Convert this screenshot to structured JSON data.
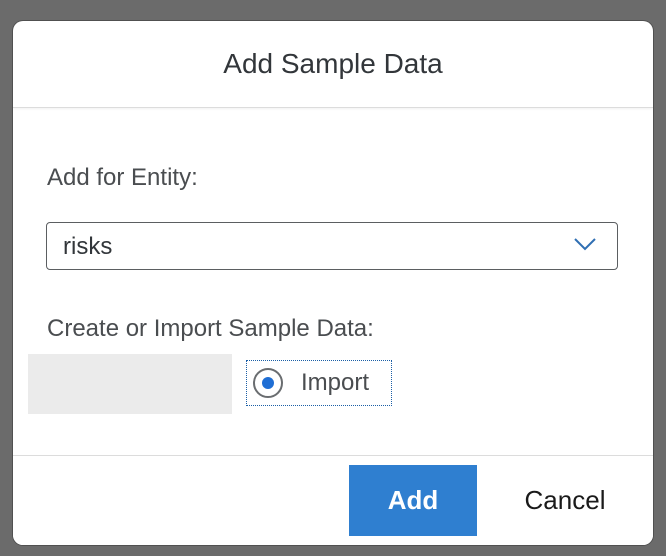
{
  "dialog": {
    "title": "Add Sample Data"
  },
  "entity": {
    "label": "Add for Entity:",
    "selected_value": "risks",
    "chevron_icon": "chevron-down-icon"
  },
  "sample_data": {
    "label": "Create or Import Sample Data:",
    "options": [
      {
        "label": "Import",
        "selected": true
      }
    ]
  },
  "footer": {
    "add_label": "Add",
    "cancel_label": "Cancel"
  },
  "colors": {
    "accent": "#2f7fd0",
    "radio_selected": "#1f6ed4",
    "overlay": "#6b6b6b"
  }
}
